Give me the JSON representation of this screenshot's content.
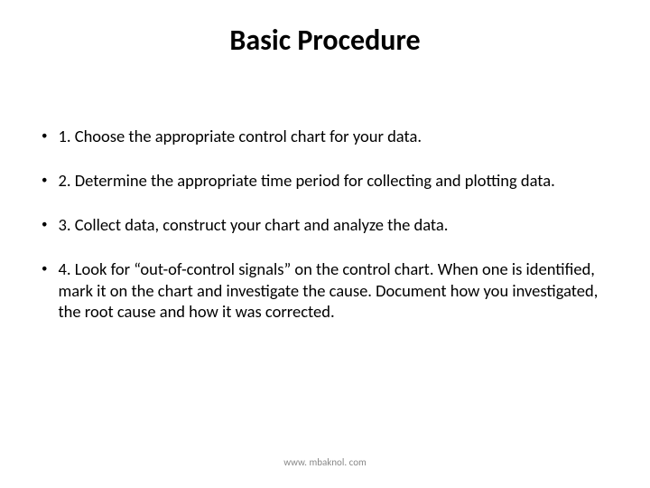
{
  "title": "Basic Procedure",
  "bullets": [
    "1. Choose the appropriate control chart for your data.",
    "2. Determine the appropriate time period for collecting and plotting data.",
    "3. Collect data, construct your chart and analyze the data.",
    "4. Look for “out-of-control signals” on the control chart. When one is identified, mark it on the chart and investigate the cause. Document how you investigated, the root cause and how it was corrected."
  ],
  "footer": "www. mbaknol. com"
}
